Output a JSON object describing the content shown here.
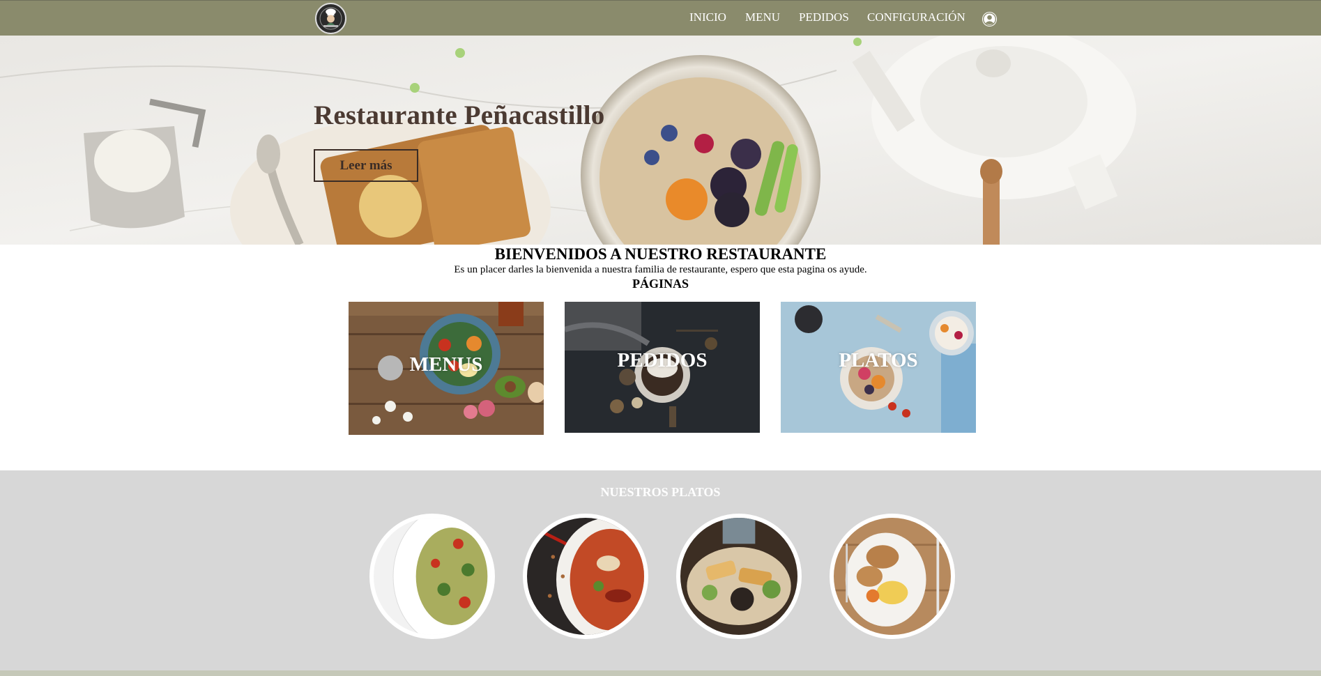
{
  "nav": {
    "logo_icon": "chef-logo-icon",
    "links": [
      {
        "label": "INICIO"
      },
      {
        "label": "MENU"
      },
      {
        "label": "PEDIDOS"
      },
      {
        "label": "CONFIGURACIÓN"
      }
    ],
    "user_icon": "user-circle-icon",
    "background": "#8a8b6c"
  },
  "hero": {
    "title": "Restaurante Peñacastillo",
    "button_label": "Leer más"
  },
  "welcome": {
    "title": "BIENVENIDOS A NUESTRO RESTAURANTE",
    "text": "Es un placer darles la bienvenida a nuestra familia de restaurante, espero que esta pagina os ayude.",
    "pages_title": "PÁGINAS"
  },
  "pages": [
    {
      "label": "MENUS"
    },
    {
      "label": "PEDIDOS"
    },
    {
      "label": "PLATOS"
    }
  ],
  "dishes": {
    "title": "NUESTROS PLATOS",
    "background": "#d7d7d7"
  }
}
